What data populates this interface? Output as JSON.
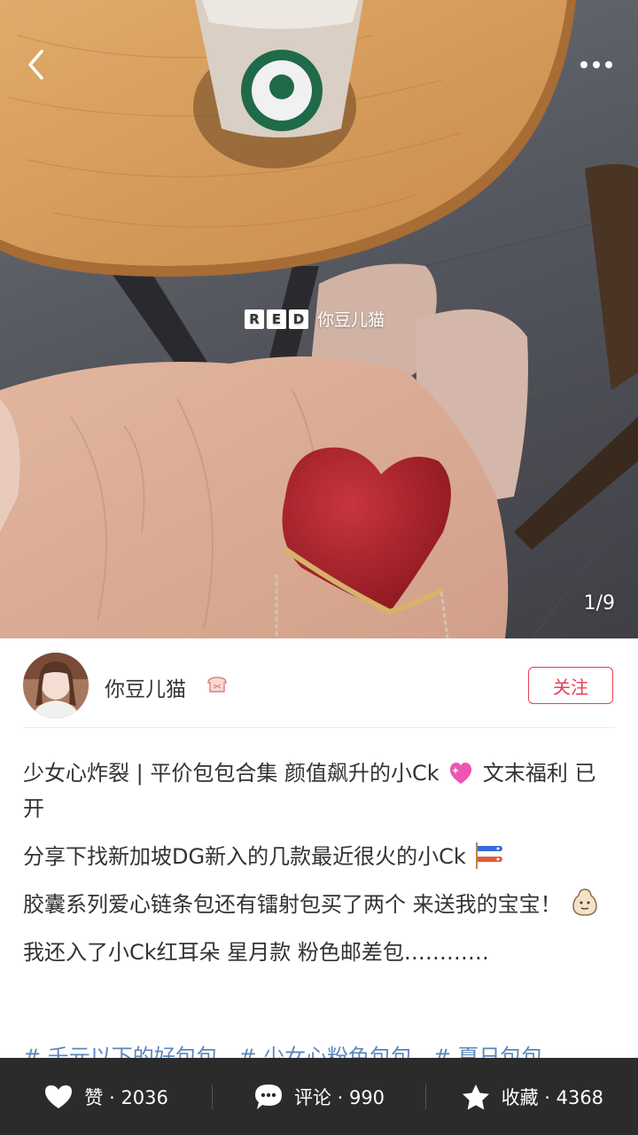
{
  "photo": {
    "watermark_logo": [
      "R",
      "E",
      "D"
    ],
    "watermark_user": "你豆儿猫",
    "counter": "1/9"
  },
  "author": {
    "name": "你豆儿猫",
    "follow_label": "关注"
  },
  "post": {
    "title_a": "少女心炸裂 | 平价包包合集 颜值飙升的小Ck",
    "title_b": "文末福利 已开",
    "line2": "分享下找新加坡DG新入的几款最近很火的小Ck",
    "line3": "胶囊系列爱心链条包还有镭射包买了两个 来送我的宝宝！",
    "line4": "我还入了小Ck红耳朵 星月款 粉色邮差包…………"
  },
  "tags": [
    "# 千元以下的好包包",
    "# 少女心粉色包包",
    "# 夏日包包"
  ],
  "bottom_bar": {
    "like_label": "赞 · 2036",
    "comment_label": "评论 · 990",
    "collect_label": "收藏 · 4368"
  },
  "colors": {
    "accent": "#e8404f",
    "tag": "#5b87bd",
    "bar_bg": "#2b2b2b"
  }
}
